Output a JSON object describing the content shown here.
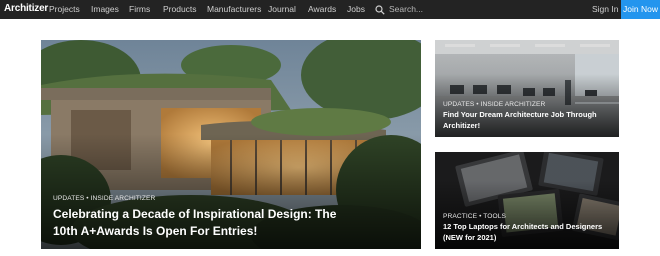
{
  "nav": {
    "logo": "Architizer",
    "items": [
      "Projects",
      "Images",
      "Firms",
      "Products",
      "Manufacturers",
      "Journal",
      "Awards",
      "Jobs"
    ],
    "search_placeholder": "Search...",
    "signin_label": "Sign In",
    "join_label": "Join Now"
  },
  "hero": {
    "category": "UPDATES • INSIDE ARCHITIZER",
    "title": "Celebrating a Decade of Inspirational Design: The 10th A+Awards Is Open For Entries!"
  },
  "side_articles": [
    {
      "category": "UPDATES • INSIDE ARCHITIZER",
      "title": "Find Your Dream Architecture Job Through Architizer!"
    },
    {
      "category": "PRACTICE • TOOLS",
      "title": "12 Top Laptops for Architects and Designers (NEW for 2021)"
    }
  ],
  "colors": {
    "nav_bg": "#232323",
    "join_bg": "#2395ee",
    "nav_text": "#cfcfcf"
  }
}
